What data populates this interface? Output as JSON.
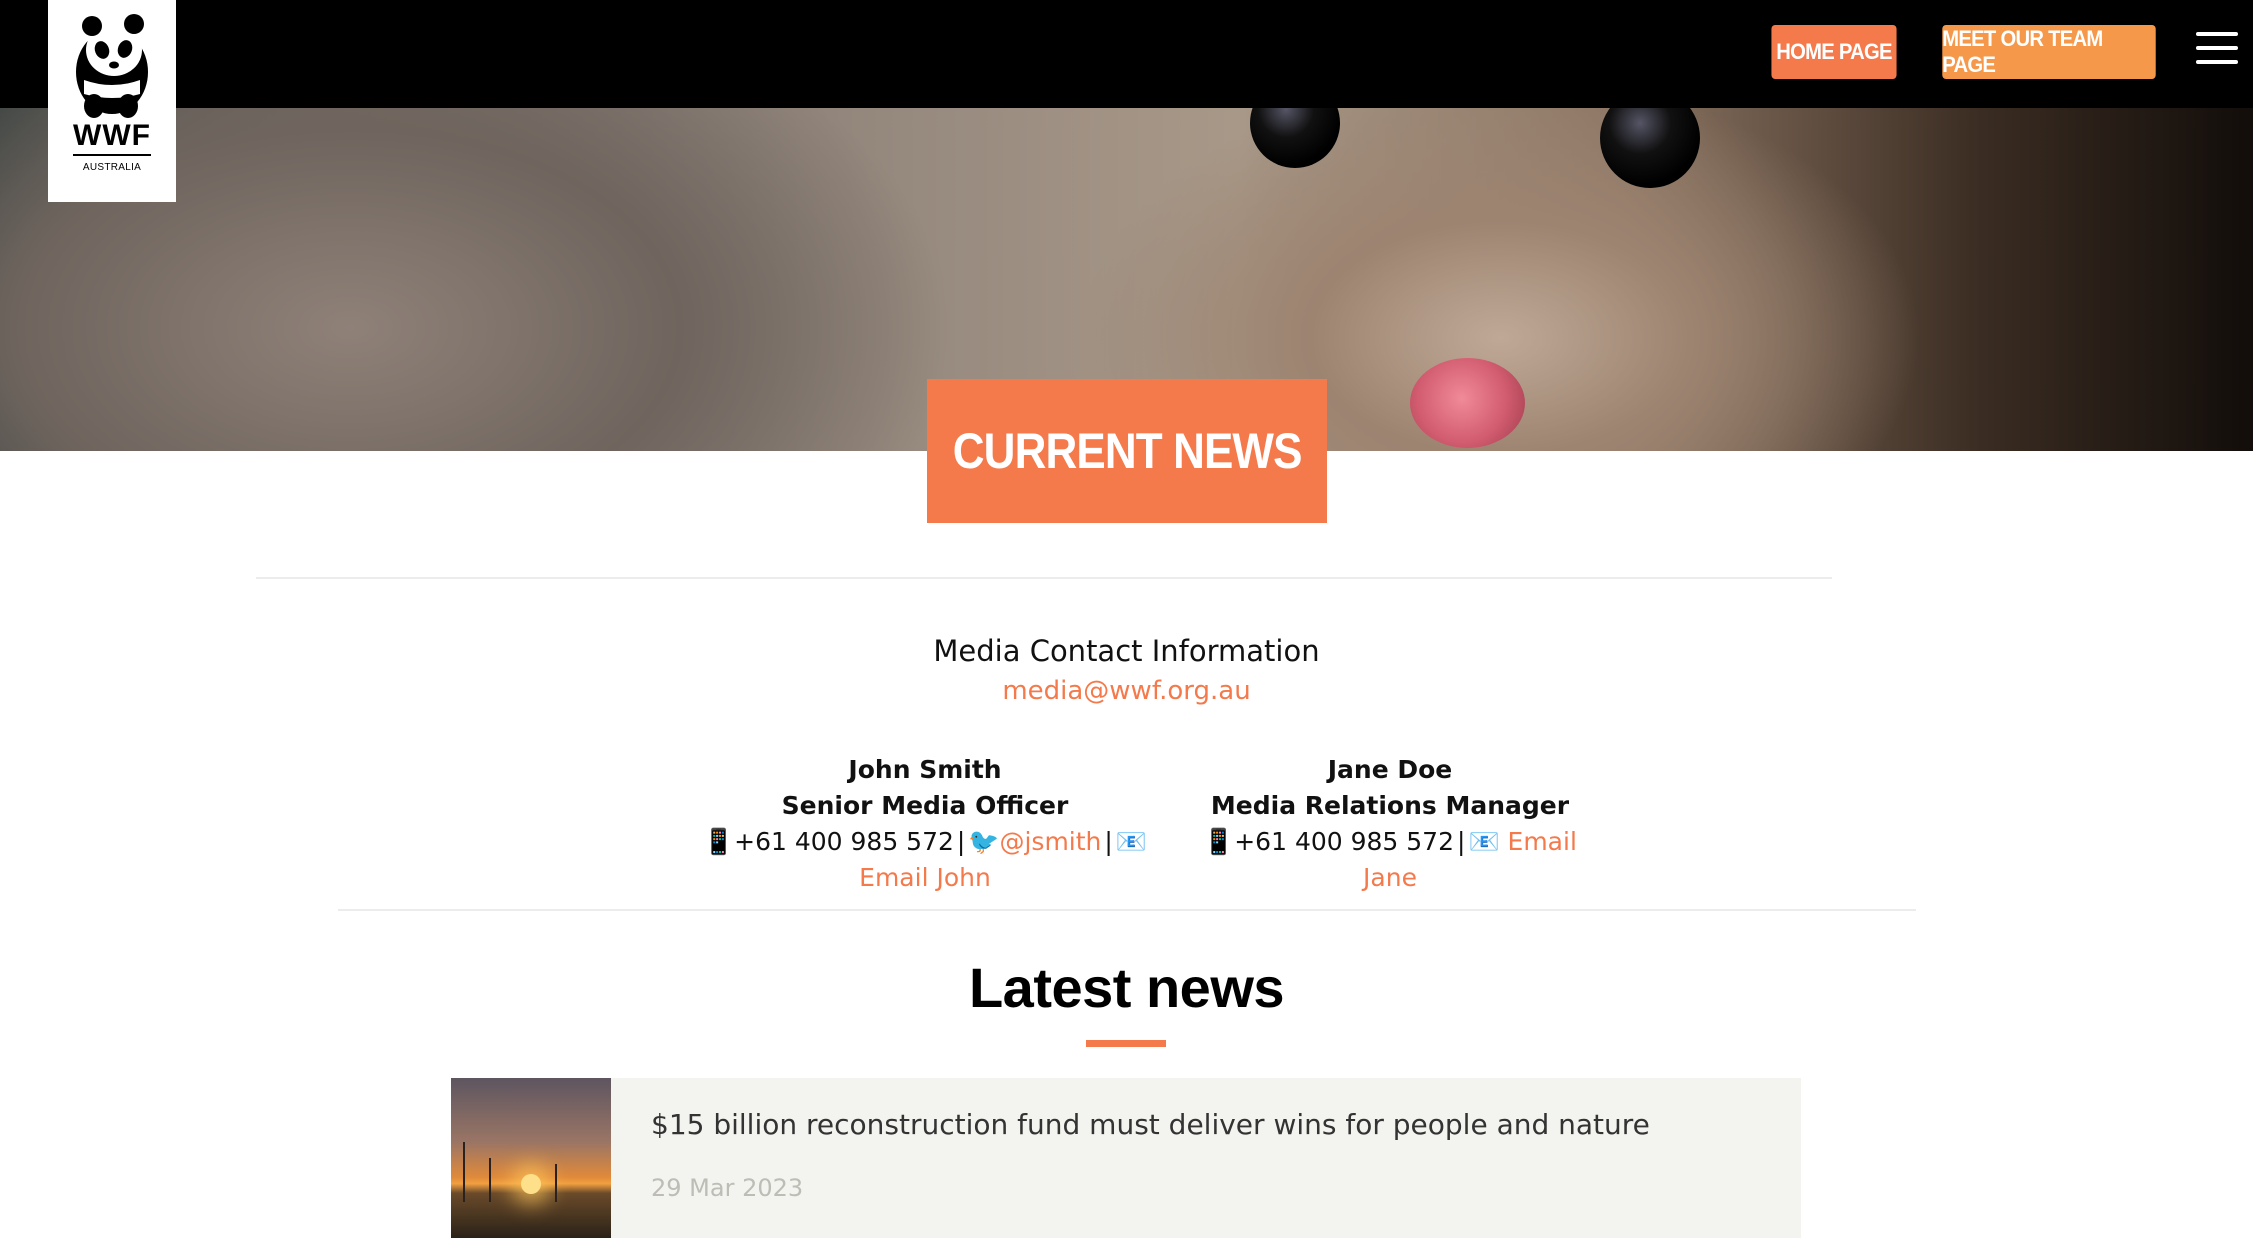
{
  "header": {
    "logo_wordmark": "WWF",
    "logo_country": "AUSTRALIA",
    "nav_home": "HOME PAGE",
    "nav_team": "MEET OUR TEAM PAGE",
    "menu_icon": "hamburger-menu-icon"
  },
  "hero": {
    "title": "CURRENT NEWS"
  },
  "media": {
    "heading": "Media Contact Information",
    "email": "media@wwf.org.au"
  },
  "contacts": [
    {
      "name": "John Smith",
      "role": "Senior Media Officer",
      "phone_icon": "📱",
      "phone": "+61 400 985 572",
      "twitter_icon": "🐦",
      "twitter": "@jsmith",
      "email_icon": "📧",
      "email_label": "Email John"
    },
    {
      "name": "Jane Doe",
      "role": "Media Relations Manager",
      "phone_icon": "📱",
      "phone": "+61 400 985 572",
      "email_icon": "📧",
      "email_label": "Email Jane"
    }
  ],
  "latest": {
    "heading": "Latest news",
    "items": [
      {
        "title": "$15 billion reconstruction fund must deliver wins for people and nature",
        "date": "29 Mar 2023"
      }
    ]
  },
  "colors": {
    "accent": "#f47a4c",
    "accent_light": "#f5984a",
    "topbar": "#000000",
    "card_bg": "#f3f3ef"
  }
}
